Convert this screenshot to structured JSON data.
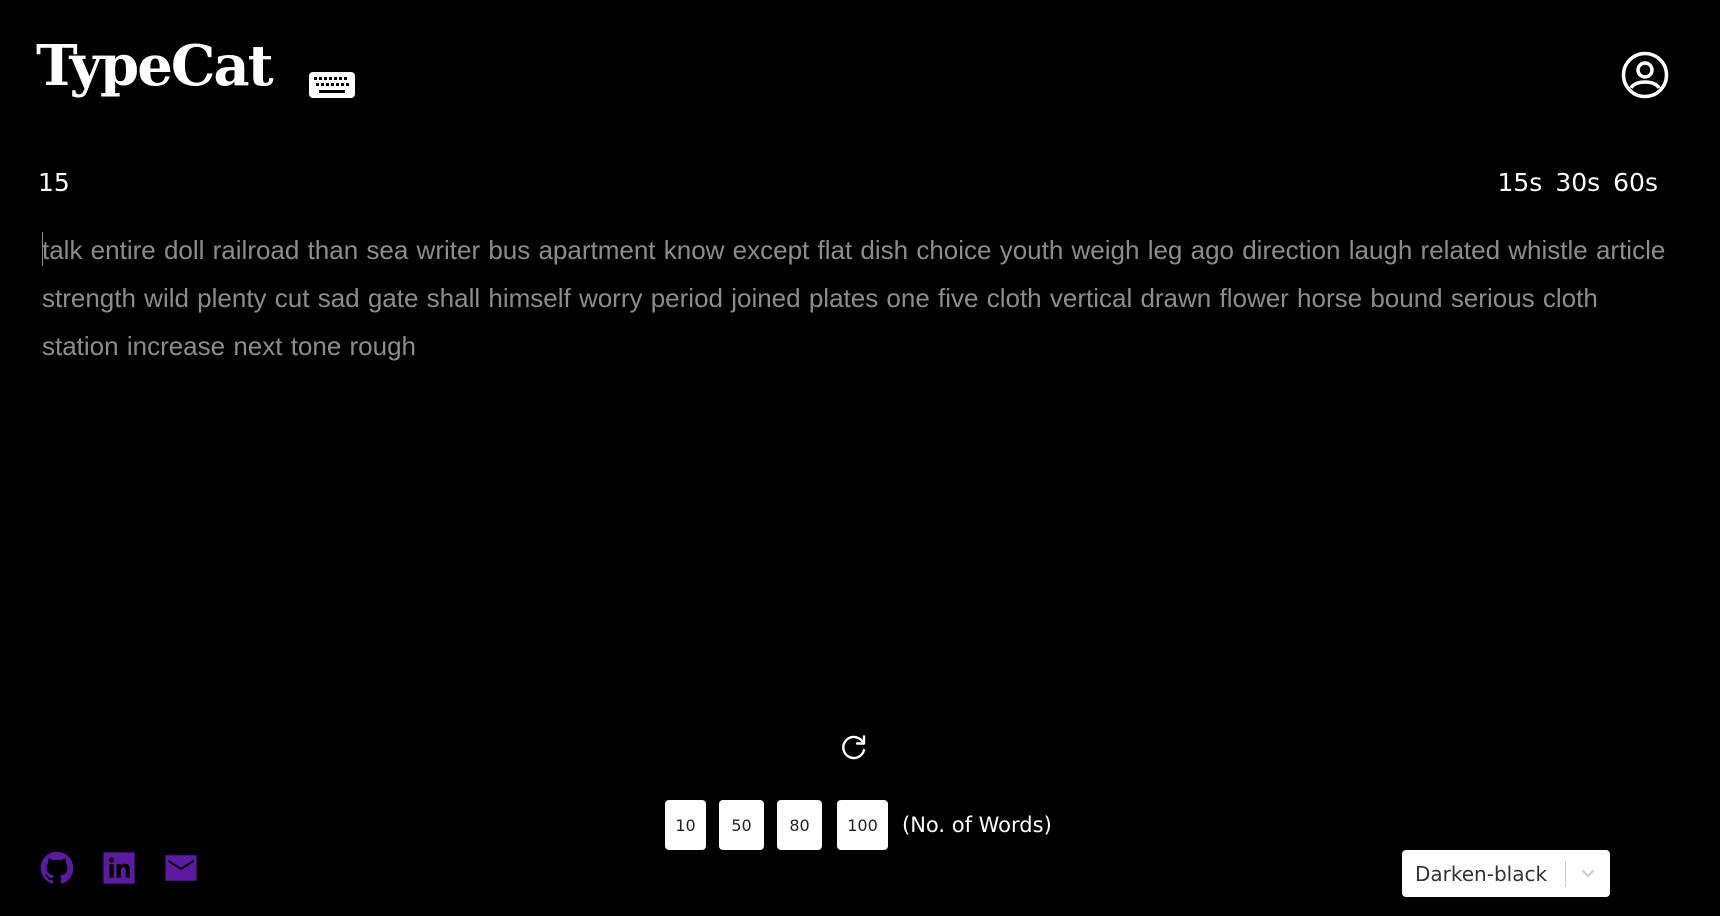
{
  "app": {
    "logo_text": "TypeCat"
  },
  "header": {
    "keyboard_icon": "keyboard-icon",
    "account_icon": "user-circle-icon"
  },
  "timer": {
    "value": "15"
  },
  "time_options": [
    {
      "label": "15s"
    },
    {
      "label": "30s"
    },
    {
      "label": "60s"
    }
  ],
  "words": {
    "text": "talk entire doll railroad than sea writer bus apartment know except flat dish choice youth weigh leg ago direction laugh related whistle article strength wild plenty cut sad gate shall himself worry period joined plates one five cloth vertical drawn flower horse bound serious cloth station increase next tone rough"
  },
  "restart": {
    "icon": "refresh-icon"
  },
  "word_count": {
    "options": [
      {
        "label": "10"
      },
      {
        "label": "50"
      },
      {
        "label": "80"
      },
      {
        "label": "100"
      }
    ],
    "caption": "(No. of Words)"
  },
  "social": {
    "icons": [
      "github-icon",
      "linkedin-icon",
      "mail-icon"
    ],
    "color": "#5b1aa0"
  },
  "theme": {
    "selected": "Darken-black"
  },
  "colors": {
    "background": "#000000",
    "text": "#ffffff",
    "untyped_words": "#8c8c8c",
    "accent": "#5b1aa0"
  }
}
